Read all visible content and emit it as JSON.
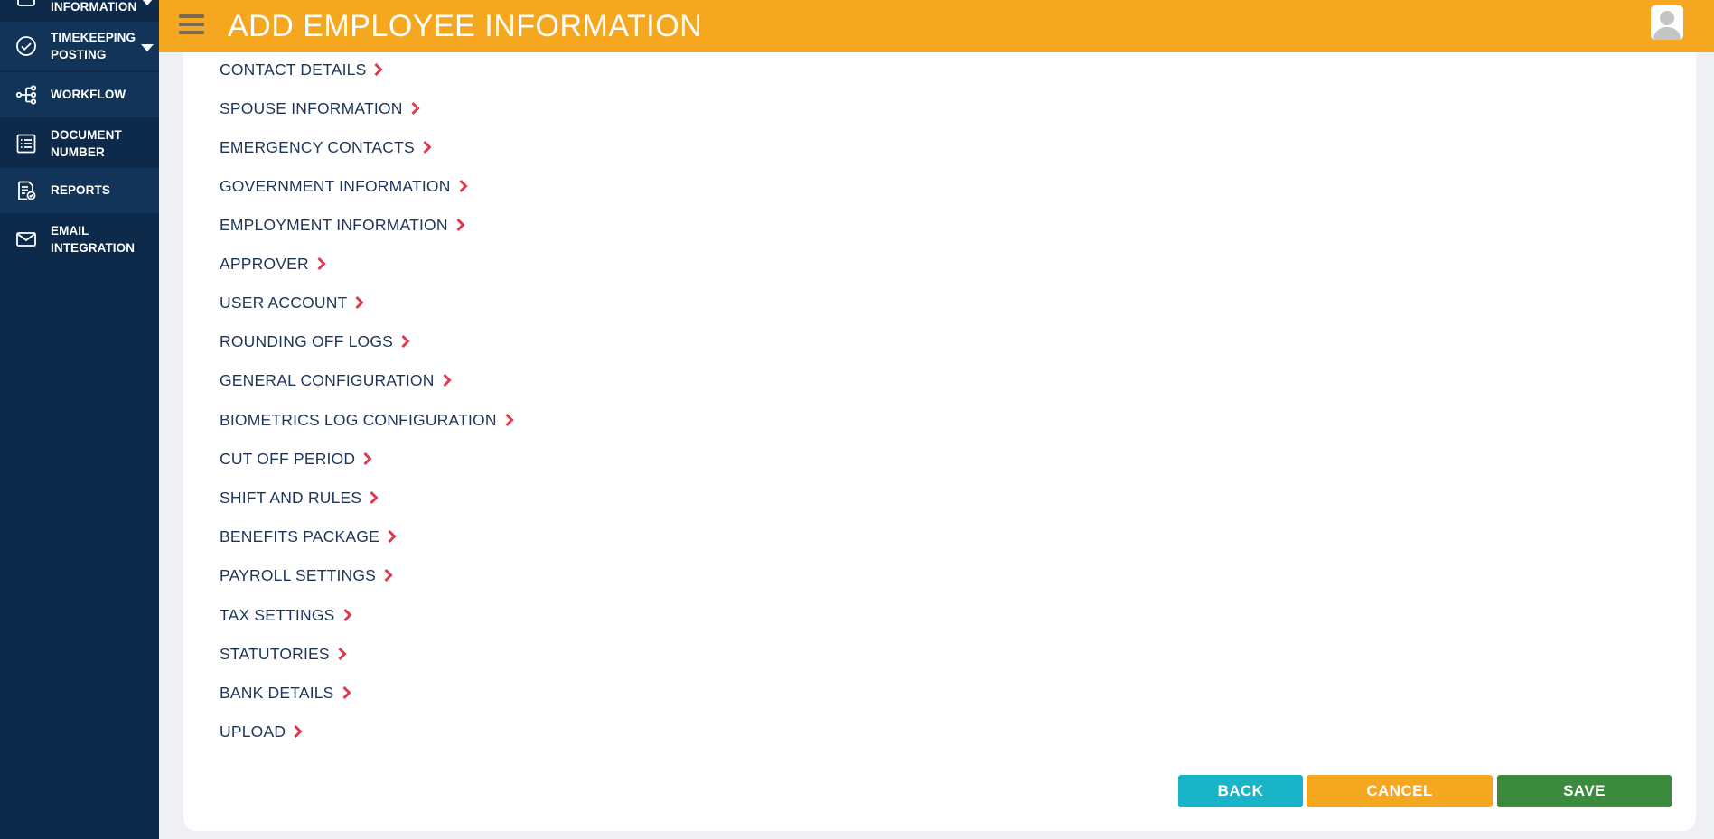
{
  "sidebar": {
    "items": [
      {
        "label": "INFORMATION",
        "icon": "document-icon",
        "has_caret": true
      },
      {
        "label": "TIMEKEEPING POSTING",
        "icon": "check-circle-icon",
        "has_caret": true
      },
      {
        "label": "WORKFLOW",
        "icon": "workflow-icon",
        "has_caret": false
      },
      {
        "label": "DOCUMENT NUMBER",
        "icon": "list-icon",
        "has_caret": false
      },
      {
        "label": "REPORTS",
        "icon": "report-icon",
        "has_caret": false
      },
      {
        "label": "EMAIL INTEGRATION",
        "icon": "mail-icon",
        "has_caret": false
      }
    ]
  },
  "header": {
    "title": "ADD EMPLOYEE INFORMATION"
  },
  "sections": [
    "CONTACT DETAILS",
    "SPOUSE INFORMATION",
    "EMERGENCY CONTACTS",
    "GOVERNMENT INFORMATION",
    "EMPLOYMENT INFORMATION",
    "APPROVER",
    "USER ACCOUNT",
    "ROUNDING OFF LOGS",
    "GENERAL CONFIGURATION",
    "BIOMETRICS LOG CONFIGURATION",
    "CUT OFF PERIOD",
    "SHIFT AND RULES",
    "BENEFITS PACKAGE",
    "PAYROLL SETTINGS",
    "TAX SETTINGS",
    "STATUTORIES",
    "BANK DETAILS",
    "UPLOAD"
  ],
  "actions": {
    "back": "BACK",
    "cancel": "CANCEL",
    "save": "SAVE"
  },
  "colors": {
    "sidebar_bg": "#0d2a4b",
    "header_bg": "#f5a81f",
    "chevron": "#e0394f",
    "back": "#1ab4c9",
    "cancel": "#f5a81f",
    "save": "#3b8a3e"
  }
}
